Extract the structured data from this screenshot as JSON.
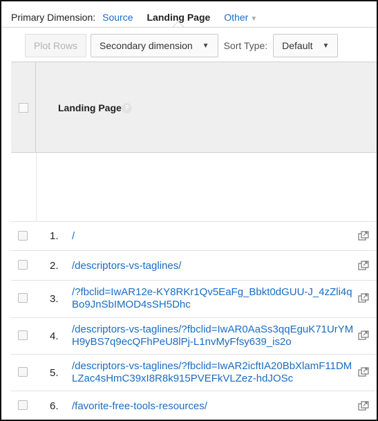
{
  "dimension": {
    "label": "Primary Dimension:",
    "options": [
      "Source",
      "Landing Page",
      "Other"
    ],
    "selected": "Landing Page"
  },
  "toolbar": {
    "plot_rows": "Plot Rows",
    "secondary_dimension": "Secondary dimension",
    "sort_type_label": "Sort Type:",
    "sort_type_value": "Default"
  },
  "table": {
    "column_header": "Landing Page",
    "help_icon": "?",
    "rows": [
      {
        "num": "1.",
        "url": "/"
      },
      {
        "num": "2.",
        "url": "/descriptors-vs-taglines/"
      },
      {
        "num": "3.",
        "url": "/?fbclid=IwAR12e-KY8RKr1Qv5EaFg_Bbkt0dGUU-J_4zZli4qBo9JnSbIMOD4sSH5Dhc"
      },
      {
        "num": "4.",
        "url": "/descriptors-vs-taglines/?fbclid=IwAR0AaSs3qqEguK71UrYMH9yBS7q9ecQFhPeU8lPj-L1nvMyFfsy639_is2o"
      },
      {
        "num": "5.",
        "url": "/descriptors-vs-taglines/?fbclid=IwAR2icftIA20BbXlamF11DMLZac4sHmC39xI8R8k915PVEFkVLZez-hdJOSc"
      },
      {
        "num": "6.",
        "url": "/favorite-free-tools-resources/"
      }
    ]
  },
  "colors": {
    "link": "#1a6cc4",
    "header_bg": "#efefef"
  }
}
